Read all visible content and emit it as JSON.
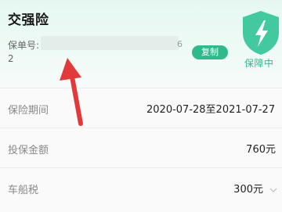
{
  "header": {
    "title": "交强险",
    "policy_label": "保单号:",
    "policy_tail": "6",
    "policy_line2": "2",
    "copy_label": "复制",
    "status_label": "保障中",
    "accent_color": "#2fba8c"
  },
  "rows": [
    {
      "label": "保险期间",
      "value": "2020-07-28至2021-07-27"
    },
    {
      "label": "投保金额",
      "value": "760元"
    },
    {
      "label": "车船税",
      "value": "300元"
    }
  ],
  "icons": {
    "shield": "shield-lightning-icon",
    "chevron": "chevron-down-icon",
    "annotation": "red-arrow-annotation"
  }
}
